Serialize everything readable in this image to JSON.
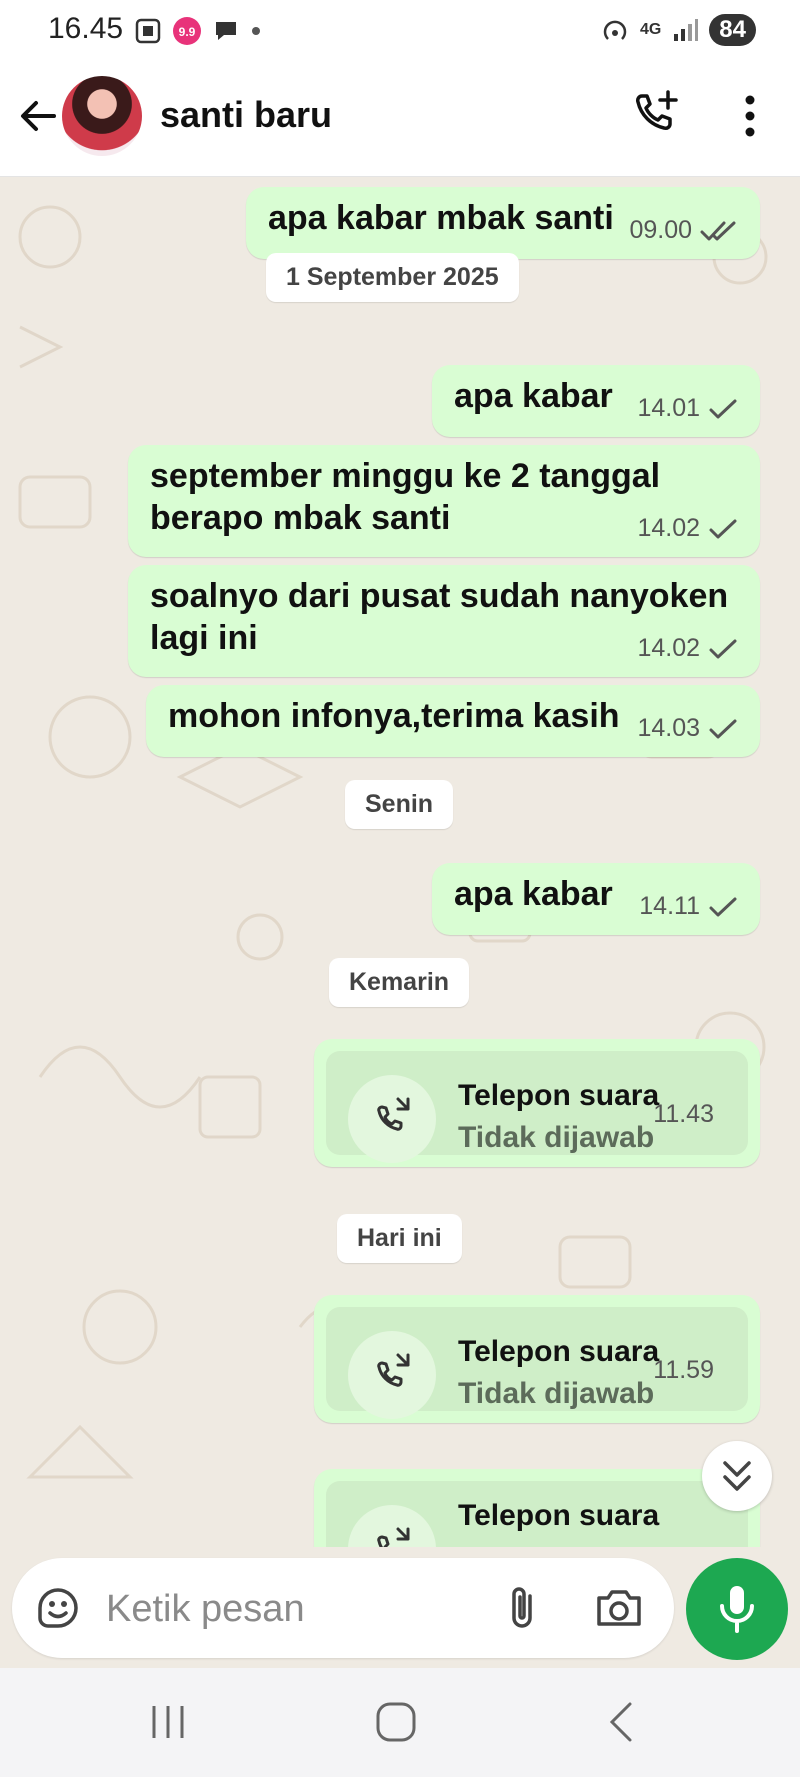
{
  "status_bar": {
    "time": "16.45",
    "network": "4G",
    "battery": "84"
  },
  "header": {
    "contact_name": "santi baru"
  },
  "messages": [
    {
      "text": "apa kabar mbak santi",
      "time": "09.00"
    },
    {
      "text": "apa kabar",
      "time": "14.01"
    },
    {
      "text": "september minggu ke 2 tanggal\nberapo mbak santi",
      "time": "14.02"
    },
    {
      "text": "soalnyo dari pusat sudah nanyoken\nlagi ini",
      "time": "14.02"
    },
    {
      "text": "mohon infonya,terima kasih",
      "time": "14.03"
    },
    {
      "text": "apa kabar",
      "time": "14.11"
    }
  ],
  "date_chips": [
    "1 September 2025",
    "Senin",
    "Kemarin",
    "Hari ini"
  ],
  "calls": [
    {
      "title": "Telepon suara",
      "subtitle": "Tidak dijawab",
      "time": "11.43"
    },
    {
      "title": "Telepon suara",
      "subtitle": "Tidak dijawab",
      "time": "11.59"
    },
    {
      "title": "Telepon suara"
    }
  ],
  "composer": {
    "placeholder": "Ketik pesan"
  },
  "colors": {
    "accent": "#1da851",
    "bubble_out": "#d9fdd3",
    "chat_bg": "#efeae2",
    "tick_read": "#53bdeb"
  }
}
